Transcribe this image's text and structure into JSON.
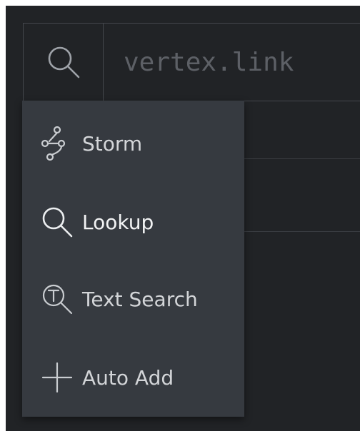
{
  "query": {
    "placeholder": "vertex.link",
    "value": "",
    "mode_icon": "search-icon"
  },
  "mode_menu": {
    "items": [
      {
        "label": "Storm",
        "icon": "storm-graph-icon"
      },
      {
        "label": "Lookup",
        "icon": "search-icon",
        "active": true
      },
      {
        "label": "Text Search",
        "icon": "text-search-icon"
      },
      {
        "label": "Auto Add",
        "icon": "plus-icon"
      }
    ]
  },
  "colors": {
    "background": "#212326",
    "menu_background": "#363a40",
    "border": "#44474c",
    "text": "#d3d5d8",
    "text_active": "#f2f3f4",
    "placeholder": "#5d6066"
  }
}
